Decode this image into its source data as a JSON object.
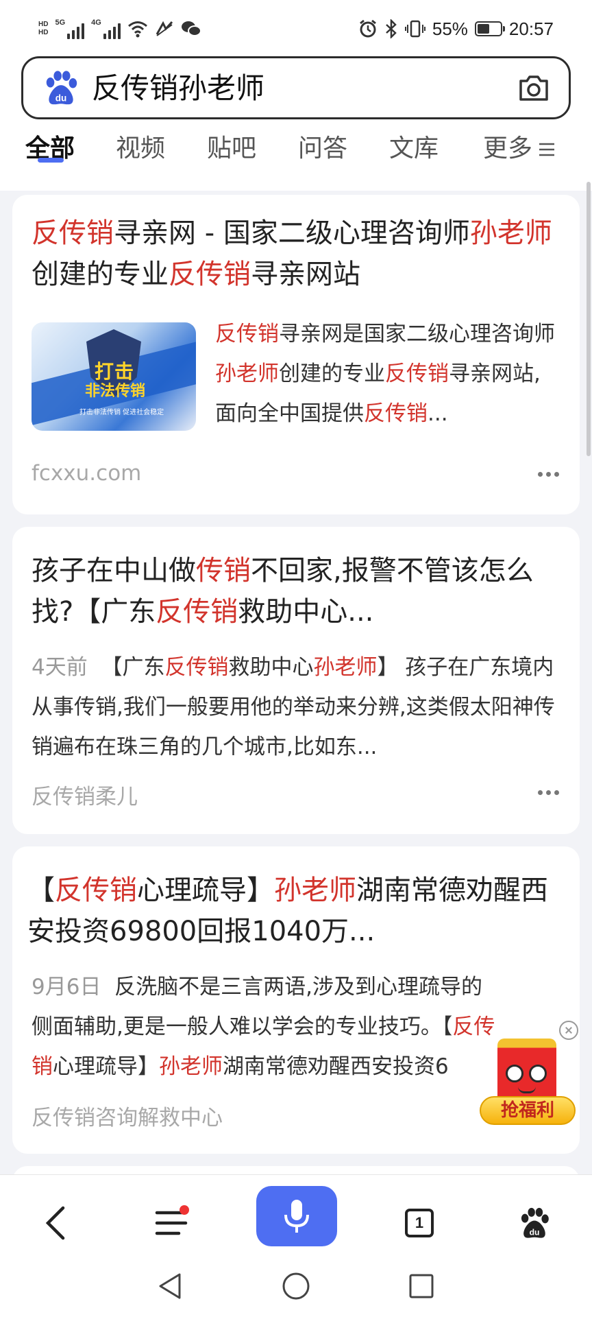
{
  "status_bar": {
    "signal1_label": "5G",
    "signal2_label": "4G",
    "battery_percent_text": "55%",
    "battery_level": 0.55,
    "time": "20:57"
  },
  "search": {
    "query": "反传销孙老师"
  },
  "tabs": [
    {
      "label": "全部",
      "active": true
    },
    {
      "label": "视频"
    },
    {
      "label": "贴吧"
    },
    {
      "label": "问答"
    },
    {
      "label": "文库"
    },
    {
      "label": "更多"
    }
  ],
  "results": [
    {
      "title_parts": [
        {
          "text": "反传销",
          "hl": true
        },
        {
          "text": "寻亲网 - 国家二级心理咨询师",
          "hl": false
        },
        {
          "text": "孙老师",
          "hl": true
        },
        {
          "text": "创建的专业",
          "hl": false
        },
        {
          "text": "反传销",
          "hl": true
        },
        {
          "text": "寻亲网站",
          "hl": false
        }
      ],
      "thumbnail_text_main": "打击",
      "thumbnail_text_sub": "非法传销",
      "thumbnail_caption": "打击非法传销 促进社会稳定",
      "snippet_parts": [
        {
          "text": "反传销",
          "hl": true
        },
        {
          "text": "寻亲网是国家二级心理咨询师",
          "hl": false
        },
        {
          "text": "孙老师",
          "hl": true
        },
        {
          "text": "创建的专业",
          "hl": false
        },
        {
          "text": "反传销",
          "hl": true
        },
        {
          "text": "寻亲网站,面向全中国提供",
          "hl": false
        },
        {
          "text": "反传销",
          "hl": true
        },
        {
          "text": "...",
          "hl": false
        }
      ],
      "source": "fcxxu.com"
    },
    {
      "title_parts": [
        {
          "text": "孩子在中山做",
          "hl": false
        },
        {
          "text": "传销",
          "hl": true
        },
        {
          "text": "不回家,报警不管该怎么找?【广东",
          "hl": false
        },
        {
          "text": "反传销",
          "hl": true
        },
        {
          "text": "救助中心...",
          "hl": false
        }
      ],
      "date": "4天前",
      "snippet_parts": [
        {
          "text": "【广东",
          "hl": false
        },
        {
          "text": "反传销",
          "hl": true
        },
        {
          "text": "救助中心",
          "hl": false
        },
        {
          "text": "孙老师",
          "hl": true
        },
        {
          "text": "】 孩子在广东境内从事传销,我们一般要用他的举动来分辨,这类假太阳神传销遍布在珠三角的几个城市,比如东...",
          "hl": false
        }
      ],
      "source": "反传销柔儿"
    },
    {
      "title_parts": [
        {
          "text": "【",
          "hl": false
        },
        {
          "text": "反传销",
          "hl": true
        },
        {
          "text": "心理疏导】",
          "hl": false
        },
        {
          "text": "孙老师",
          "hl": true
        },
        {
          "text": "湖南常德劝醒西安投资69800回报1040万...",
          "hl": false
        }
      ],
      "date": "9月6日",
      "snippet_parts": [
        {
          "text": "反洗脑不是三言两语,涉及到心理疏导的侧面辅助,更是一般人难以学会的专业技巧。【",
          "hl": false
        },
        {
          "text": "反传销",
          "hl": true
        },
        {
          "text": "心理疏导】",
          "hl": false
        },
        {
          "text": "孙老师",
          "hl": true
        },
        {
          "text": "湖南常德劝醒西安投资6",
          "hl": false
        }
      ],
      "source": "反传销咨询解救中心"
    }
  ],
  "welfare_widget": {
    "label": "抢福利"
  },
  "bottom_bar": {
    "open_tabs_count": "1"
  },
  "icons": {
    "logo": "baidu-paw-icon",
    "camera": "camera-icon",
    "more": "menu-lines-icon",
    "back": "chevron-left-icon",
    "menu": "menu-icon",
    "voice": "microphone-icon",
    "tabs": "tab-count-icon",
    "home": "baidu-paw-icon"
  },
  "colors": {
    "highlight": "#d2342c",
    "accent": "#4e6ef2"
  }
}
